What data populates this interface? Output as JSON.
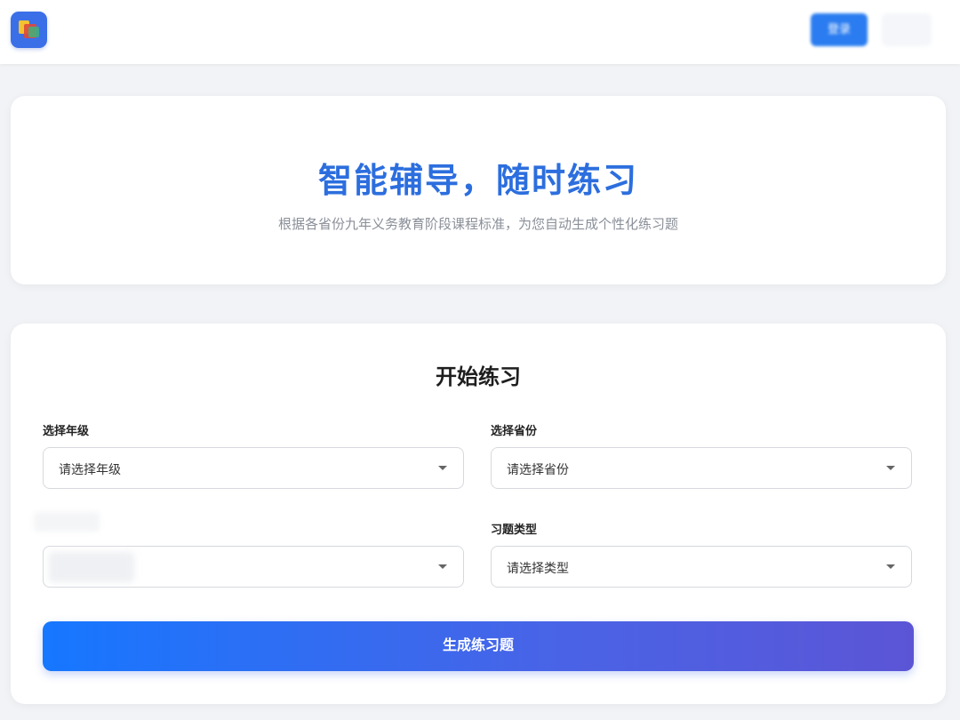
{
  "header": {
    "login_label": "登录",
    "logo_icon": "app-logo-icon"
  },
  "hero": {
    "title": "智能辅导，随时练习",
    "subtitle": "根据各省份九年义务教育阶段课程标准，为您自动生成个性化练习题"
  },
  "form": {
    "title": "开始练习",
    "grade": {
      "label": "选择年级",
      "value": "请选择年级"
    },
    "province": {
      "label": "选择省份",
      "value": "请选择省份"
    },
    "type": {
      "label": "习题类型",
      "value": "请选择类型"
    },
    "submit_label": "生成练习题"
  },
  "colors": {
    "accent": "#2c6ede",
    "button_start": "#1677ff",
    "button_end": "#5b55d6",
    "background": "#f1f3f6"
  }
}
